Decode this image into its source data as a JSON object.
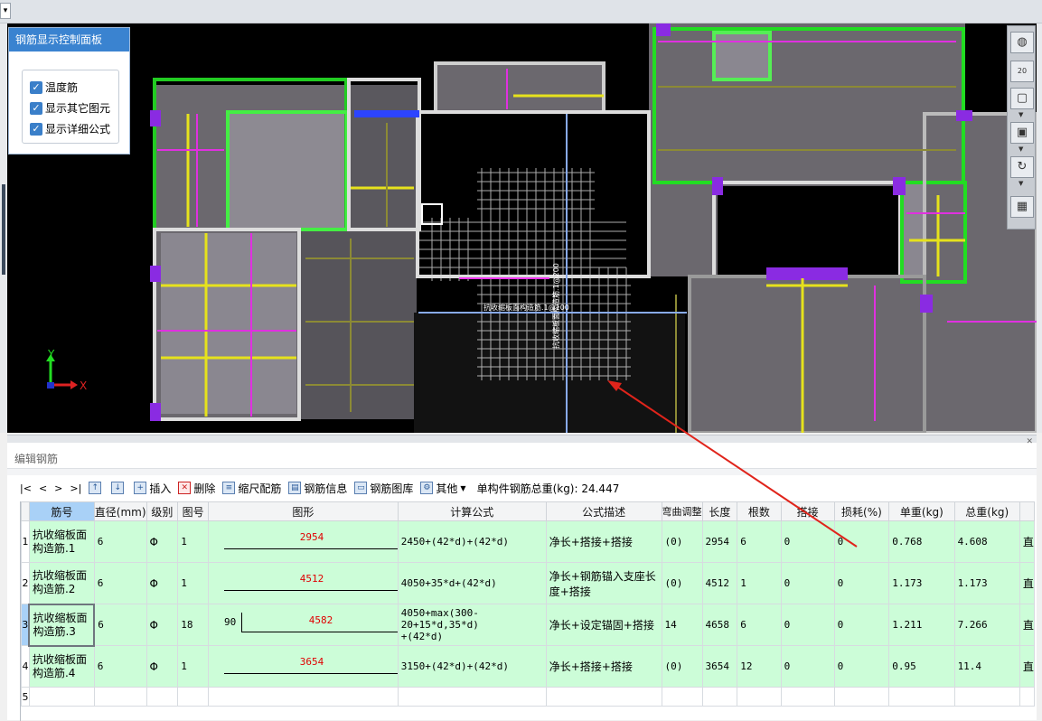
{
  "colors": {
    "accent": "#3a83d0",
    "row_bg": "#ccfdd8",
    "shape_number": "#e00000",
    "annotation_arrow": "#e0241b"
  },
  "control_panel": {
    "title": "钢筋显示控制面板",
    "checkboxes": [
      {
        "label": "温度筋",
        "checked": true
      },
      {
        "label": "显示其它图元",
        "checked": true
      },
      {
        "label": "显示详细公式",
        "checked": true
      }
    ]
  },
  "viewport": {
    "axis_x": "X",
    "axis_y": "Y",
    "grid_label_1": "抗收缩板面构造筋.1@100",
    "grid_label_2": "抗收缩板面构造筋.1@200",
    "tool_zoom_label": "20"
  },
  "edit_panel": {
    "title": "编辑钢筋",
    "nav": [
      "|<",
      "<",
      ">",
      ">|"
    ],
    "toolbar": {
      "insert": "插入",
      "delete": "删除",
      "scale_rebar": "缩尺配筋",
      "rebar_info": "钢筋信息",
      "rebar_library": "钢筋图库",
      "other": "其他",
      "total_weight_label": "单构件钢筋总重(kg): 24.447"
    },
    "columns": [
      "筋号",
      "直径(mm)",
      "级别",
      "图号",
      "图形",
      "计算公式",
      "公式描述",
      "弯曲调整",
      "长度",
      "根数",
      "搭接",
      "损耗(%)",
      "单重(kg)",
      "总重(kg)",
      "直"
    ],
    "rows": [
      {
        "no": "1",
        "name_line1": "抗收缩板面",
        "name_line2": "构造筋.1",
        "diameter": "6",
        "grade": "Φ",
        "fig": "1",
        "hook": "",
        "shape_value": "2954",
        "formula_line1": "2450+(42*d)+(42*d)",
        "formula_line2": "",
        "desc_line1": "净长+搭接+搭接",
        "desc_line2": "",
        "bend": "(0)",
        "length": "2954",
        "count": "6",
        "lap": "0",
        "loss": "0",
        "unit_weight": "0.768",
        "total_weight": "4.608",
        "extra": "直"
      },
      {
        "no": "2",
        "name_line1": "抗收缩板面",
        "name_line2": "构造筋.2",
        "diameter": "6",
        "grade": "Φ",
        "fig": "1",
        "hook": "",
        "shape_value": "4512",
        "formula_line1": "4050+35*d+(42*d)",
        "formula_line2": "",
        "desc_line1": "净长+钢筋锚入支座长",
        "desc_line2": "度+搭接",
        "bend": "(0)",
        "length": "4512",
        "count": "1",
        "lap": "0",
        "loss": "0",
        "unit_weight": "1.173",
        "total_weight": "1.173",
        "extra": "直"
      },
      {
        "no": "3",
        "name_line1": "抗收缩板面",
        "name_line2": "构造筋.3",
        "diameter": "6",
        "grade": "Φ",
        "fig": "18",
        "hook": "90",
        "shape_value": "4582",
        "formula_line1": "4050+max(300-20+15*d,35*d)",
        "formula_line2": "+(42*d)",
        "desc_line1": "净长+设定锚固+搭接",
        "desc_line2": "",
        "bend": "14",
        "length": "4658",
        "count": "6",
        "lap": "0",
        "loss": "0",
        "unit_weight": "1.211",
        "total_weight": "7.266",
        "extra": "直"
      },
      {
        "no": "4",
        "name_line1": "抗收缩板面",
        "name_line2": "构造筋.4",
        "diameter": "6",
        "grade": "Φ",
        "fig": "1",
        "hook": "",
        "shape_value": "3654",
        "formula_line1": "3150+(42*d)+(42*d)",
        "formula_line2": "",
        "desc_line1": "净长+搭接+搭接",
        "desc_line2": "",
        "bend": "(0)",
        "length": "3654",
        "count": "12",
        "lap": "0",
        "loss": "0",
        "unit_weight": "0.95",
        "total_weight": "11.4",
        "extra": "直"
      }
    ],
    "empty_row_no": "5"
  }
}
